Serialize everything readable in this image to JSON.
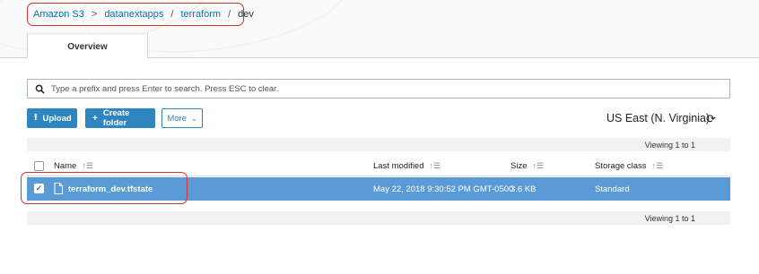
{
  "breadcrumb": {
    "items": [
      "Amazon S3",
      "datanextapps",
      "terraform",
      "dev"
    ],
    "separators": [
      ">",
      "/",
      "/"
    ]
  },
  "tabs": [
    {
      "label": "Overview"
    }
  ],
  "search": {
    "placeholder": "Type a prefix and press Enter to search. Press ESC to clear.",
    "value": ""
  },
  "toolbar": {
    "upload_label": "Upload",
    "create_folder_label": "Create folder",
    "more_label": "More",
    "region": "US East (N. Virginia)"
  },
  "viewing_top": "Viewing 1 to 1",
  "viewing_bottom": "Viewing 1 to 1",
  "table": {
    "columns": [
      "Name",
      "Last modified",
      "Size",
      "Storage class"
    ],
    "rows": [
      {
        "name": "terraform_dev.tfstate",
        "last_modified": "May 22, 2018 9:30:52 PM GMT-0500",
        "size": "3.6 KB",
        "storage_class": "Standard",
        "selected": true
      }
    ]
  },
  "colors": {
    "accent": "#2e86c1",
    "selected_row": "#5b9bd5",
    "highlight": "#d9332b",
    "link": "#0073bb"
  }
}
